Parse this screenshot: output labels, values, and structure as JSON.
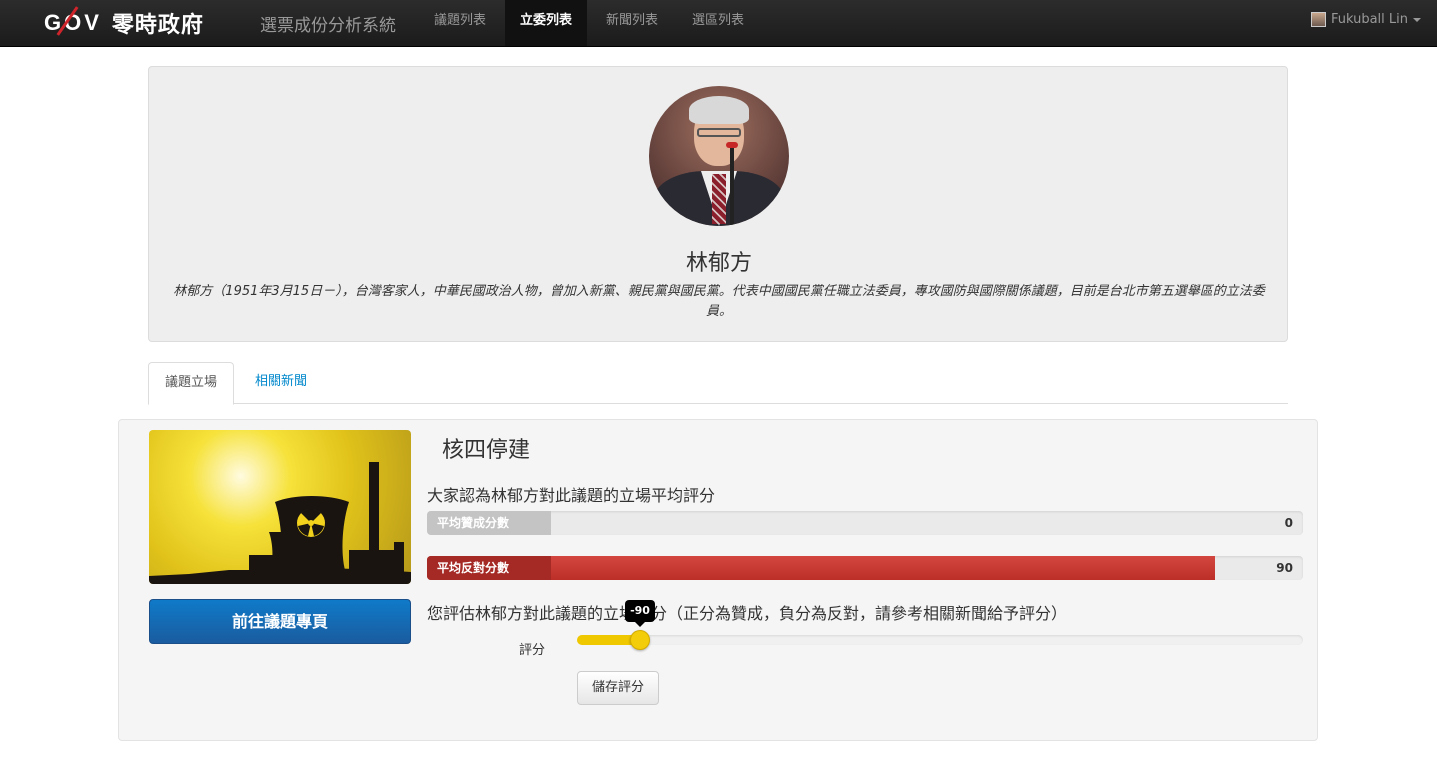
{
  "nav": {
    "logo_gov": "GOV",
    "logo_cn": "零時政府",
    "brand_sub": "選票成份分析系統",
    "items": [
      {
        "label": "議題列表"
      },
      {
        "label": "立委列表"
      },
      {
        "label": "新聞列表"
      },
      {
        "label": "選區列表"
      }
    ],
    "active_index": 1,
    "user_name": "Fukuball Lin"
  },
  "profile": {
    "name": "林郁方",
    "bio": "林郁方（1951年3月15日－），台灣客家人，中華民國政治人物，曾加入新黨、親民黨與國民黨。代表中國國民黨任職立法委員，專攻國防與國際關係議題，目前是台北市第五選舉區的立法委員。"
  },
  "tabs": [
    {
      "label": "議題立場"
    },
    {
      "label": "相關新聞"
    }
  ],
  "issue": {
    "title": "核四停建",
    "go_button": "前往議題專頁",
    "avg_label": "大家認為林郁方對此議題的立場平均評分",
    "support": {
      "label": "平均贊成分數",
      "value": "0",
      "percent": 0
    },
    "oppose": {
      "label": "平均反對分數",
      "value": "90",
      "percent": 90
    },
    "rate_prompt": "您評估林郁方對此議題的立場評分（正分為贊成，負分為反對，請參考相關新聞給予評分）",
    "score_label": "評分",
    "slider": {
      "value": "-90",
      "min": -100,
      "max": 100
    },
    "save_button": "儲存評分"
  },
  "colors": {
    "navbar": "#1b1b1b",
    "oppose_bar": "#c9302c",
    "support_bar": "#c4c4c4",
    "primary_button": "#1a6fb5",
    "slider": "#f0c800"
  }
}
